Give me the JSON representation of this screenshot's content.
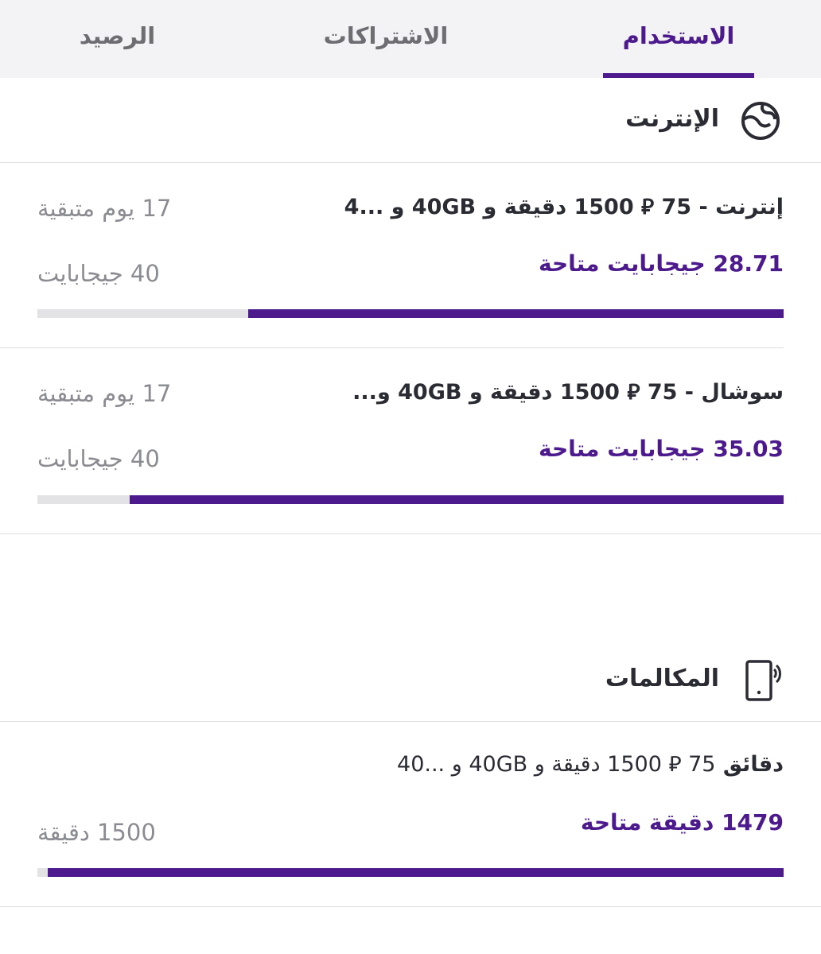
{
  "tabs": [
    {
      "label": "الاستخدام",
      "active": true
    },
    {
      "label": "الاشتراكات",
      "active": false
    },
    {
      "label": "الرصيد",
      "active": false
    }
  ],
  "internet": {
    "title": "الإنترنت",
    "icon": "globe-icon",
    "items": [
      {
        "title": "إنترنت - 75 ⃁ 1500 دقيقة و 40GB و ...4",
        "remaining": "17 يوم متبقية",
        "available": "28.71 جيجابايت متاحة",
        "total": "40 جيجابايت",
        "fraction_available": 0.718
      },
      {
        "title": "سوشال - 75 ⃁ 1500 دقيقة و 40GB و...",
        "remaining": "17 يوم متبقية",
        "available": "35.03 جيجابايت متاحة",
        "total": "40 جيجابايت",
        "fraction_available": 0.876
      }
    ]
  },
  "calls": {
    "title": "المكالمات",
    "icon": "phone-call-icon",
    "items": [
      {
        "title_bold": "دقائق",
        "title_rest": "75 ⃁ 1500 دقيقة و 40GB و ...40",
        "available": "1479 دقيقة متاحة",
        "total": "1500 دقيقة",
        "fraction_available": 0.986
      }
    ]
  },
  "colors": {
    "accent": "#4c1a8c",
    "muted": "#8b8b92",
    "track": "#e3e3e6"
  }
}
